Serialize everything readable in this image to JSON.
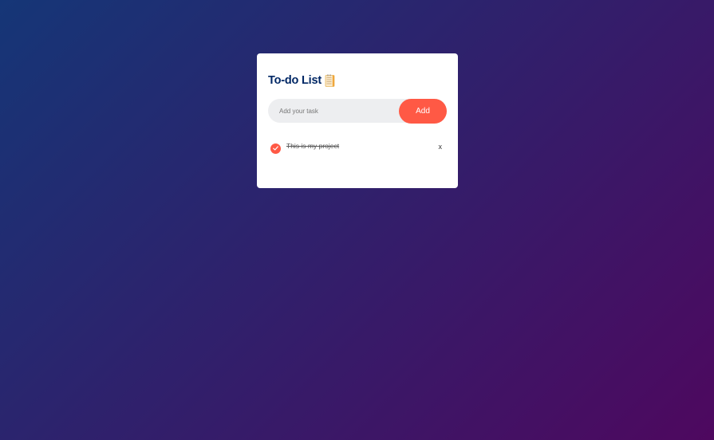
{
  "app": {
    "title": "To-do List"
  },
  "input": {
    "placeholder": "Add your task",
    "value": ""
  },
  "add_button": {
    "label": "Add"
  },
  "tasks": [
    {
      "text": "This is my project",
      "checked": true,
      "delete_label": "x"
    }
  ],
  "colors": {
    "accent": "#ff5945",
    "title": "#002765",
    "background_start": "#153677",
    "background_end": "#4e085f"
  },
  "icons": {
    "title_icon": "notepad-icon",
    "check_icon": "checkmark-icon"
  }
}
